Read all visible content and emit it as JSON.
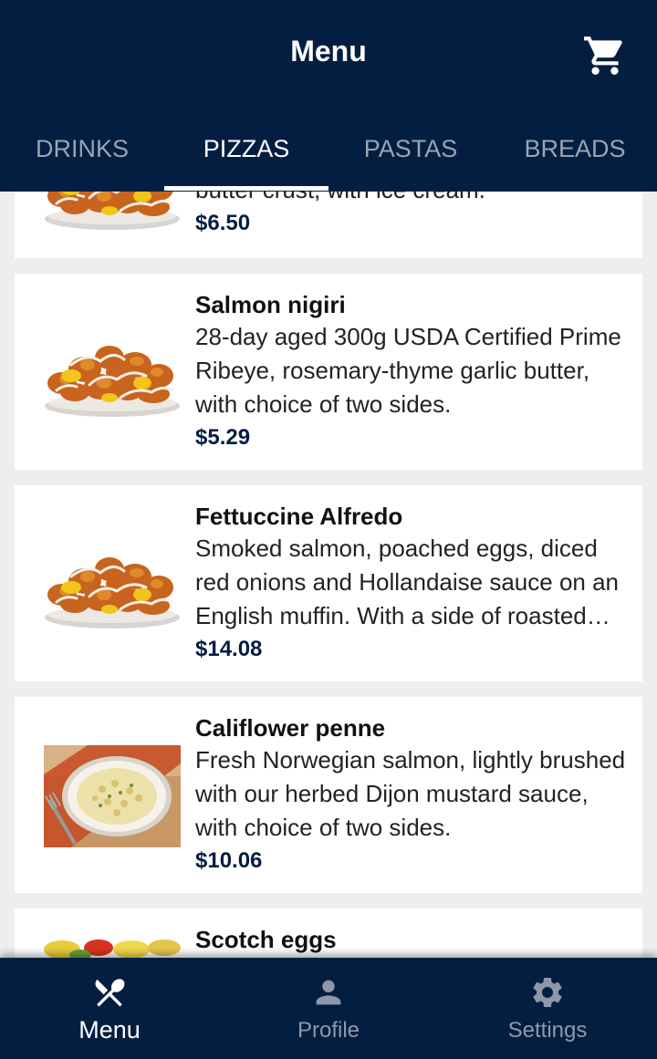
{
  "header": {
    "title": "Menu",
    "cart_icon": "shopping-cart-icon"
  },
  "tabs": [
    {
      "label": "DRINKS",
      "active": false
    },
    {
      "label": "PIZZAS",
      "active": true
    },
    {
      "label": "PASTAS",
      "active": false
    },
    {
      "label": "BREADS",
      "active": false
    }
  ],
  "items": [
    {
      "name": "",
      "description": "butter crust, with ice cream.",
      "price": "$6.50",
      "image": "pizza-bites-photo"
    },
    {
      "name": "Salmon nigiri",
      "description": "28-day aged 300g USDA Certified Prime Ribeye, rosemary-thyme garlic butter, with choice of two sides.",
      "price": "$5.29",
      "image": "pizza-bites-photo"
    },
    {
      "name": "Fettuccine Alfredo",
      "description": "Smoked salmon, poached eggs, diced red onions and Hollandaise sauce on an English muffin. With a side of roasted potatoes.",
      "price": "$14.08",
      "image": "pizza-bites-photo"
    },
    {
      "name": "Califlower penne",
      "description": "Fresh Norwegian salmon, lightly brushed with our herbed Dijon mustard sauce, with choice of two sides.",
      "price": "$10.06",
      "image": "pasta-plate-photo"
    },
    {
      "name": "Scotch eggs",
      "description": "",
      "price": "",
      "image": "salad-photo"
    }
  ],
  "bottom_nav": [
    {
      "label": "Menu",
      "icon": "fork-knife-icon",
      "active": true
    },
    {
      "label": "Profile",
      "icon": "person-icon",
      "active": false
    },
    {
      "label": "Settings",
      "icon": "gear-icon",
      "active": false
    }
  ],
  "colors": {
    "primary": "#041e42",
    "background": "#eeeeee",
    "card": "#ffffff",
    "inactive": "#9aa3b1"
  }
}
